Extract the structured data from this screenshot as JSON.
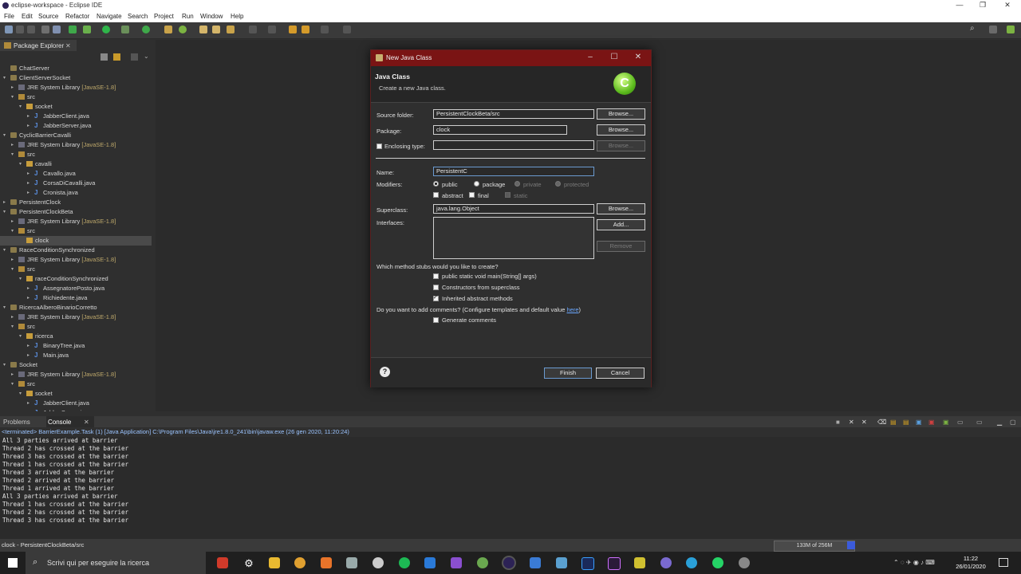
{
  "window": {
    "title": "eclipse-workspace - Eclipse IDE",
    "controls": [
      "—",
      "❐",
      "✕"
    ]
  },
  "menu": [
    "File",
    "Edit",
    "Source",
    "Refactor",
    "Navigate",
    "Search",
    "Project",
    "Run",
    "Window",
    "Help"
  ],
  "explorer": {
    "tab_label": "Package Explorer",
    "items": [
      {
        "label": "ChatServer",
        "suffix": "",
        "arrow": "",
        "icon": "project",
        "indent": 0
      },
      {
        "label": "ClientServerSocket",
        "suffix": "",
        "arrow": "▾",
        "icon": "project",
        "indent": 0
      },
      {
        "label": "JRE System Library",
        "suffix": "[JavaSE-1.8]",
        "arrow": "▸",
        "icon": "library",
        "indent": 1
      },
      {
        "label": "src",
        "suffix": "",
        "arrow": "▾",
        "icon": "src",
        "indent": 1
      },
      {
        "label": "socket",
        "suffix": "",
        "arrow": "▾",
        "icon": "package",
        "indent": 2
      },
      {
        "label": "JabberClient.java",
        "suffix": "",
        "arrow": "▸",
        "icon": "java",
        "indent": 3
      },
      {
        "label": "JabberServer.java",
        "suffix": "",
        "arrow": "▸",
        "icon": "java",
        "indent": 3
      },
      {
        "label": "CyclicBarrierCavalli",
        "suffix": "",
        "arrow": "▾",
        "icon": "project",
        "indent": 0
      },
      {
        "label": "JRE System Library",
        "suffix": "[JavaSE-1.8]",
        "arrow": "▸",
        "icon": "library",
        "indent": 1
      },
      {
        "label": "src",
        "suffix": "",
        "arrow": "▾",
        "icon": "src",
        "indent": 1
      },
      {
        "label": "cavalli",
        "suffix": "",
        "arrow": "▾",
        "icon": "package",
        "indent": 2
      },
      {
        "label": "Cavallo.java",
        "suffix": "",
        "arrow": "▸",
        "icon": "java",
        "indent": 3
      },
      {
        "label": "CorsaDiCavalli.java",
        "suffix": "",
        "arrow": "▸",
        "icon": "java",
        "indent": 3
      },
      {
        "label": "Cronista.java",
        "suffix": "",
        "arrow": "▸",
        "icon": "java",
        "indent": 3
      },
      {
        "label": "PersistentClock",
        "suffix": "",
        "arrow": "▸",
        "icon": "project",
        "indent": 0
      },
      {
        "label": "PersistentClockBeta",
        "suffix": "",
        "arrow": "▾",
        "icon": "project",
        "indent": 0
      },
      {
        "label": "JRE System Library",
        "suffix": "[JavaSE-1.8]",
        "arrow": "▸",
        "icon": "library",
        "indent": 1
      },
      {
        "label": "src",
        "suffix": "",
        "arrow": "▾",
        "icon": "src",
        "indent": 1
      },
      {
        "label": "clock",
        "suffix": "",
        "arrow": "",
        "icon": "package",
        "indent": 2,
        "selected": true
      },
      {
        "label": "RaceConditionSynchronized",
        "suffix": "",
        "arrow": "▾",
        "icon": "project",
        "indent": 0
      },
      {
        "label": "JRE System Library",
        "suffix": "[JavaSE-1.8]",
        "arrow": "▸",
        "icon": "library",
        "indent": 1
      },
      {
        "label": "src",
        "suffix": "",
        "arrow": "▾",
        "icon": "src",
        "indent": 1
      },
      {
        "label": "raceConditionSynchronized",
        "suffix": "",
        "arrow": "▾",
        "icon": "package",
        "indent": 2
      },
      {
        "label": "AssegnatorePosto.java",
        "suffix": "",
        "arrow": "▸",
        "icon": "java",
        "indent": 3
      },
      {
        "label": "Richiedente.java",
        "suffix": "",
        "arrow": "▸",
        "icon": "java",
        "indent": 3
      },
      {
        "label": "RicercaAlberoBinarioCorretto",
        "suffix": "",
        "arrow": "▾",
        "icon": "project",
        "indent": 0
      },
      {
        "label": "JRE System Library",
        "suffix": "[JavaSE-1.8]",
        "arrow": "▸",
        "icon": "library",
        "indent": 1
      },
      {
        "label": "src",
        "suffix": "",
        "arrow": "▾",
        "icon": "src",
        "indent": 1
      },
      {
        "label": "ricerca",
        "suffix": "",
        "arrow": "▾",
        "icon": "package",
        "indent": 2
      },
      {
        "label": "BinaryTree.java",
        "suffix": "",
        "arrow": "▸",
        "icon": "java",
        "indent": 3
      },
      {
        "label": "Main.java",
        "suffix": "",
        "arrow": "▸",
        "icon": "java",
        "indent": 3
      },
      {
        "label": "Socket",
        "suffix": "",
        "arrow": "▾",
        "icon": "project",
        "indent": 0
      },
      {
        "label": "JRE System Library",
        "suffix": "[JavaSE-1.8]",
        "arrow": "▸",
        "icon": "library",
        "indent": 1
      },
      {
        "label": "src",
        "suffix": "",
        "arrow": "▾",
        "icon": "src",
        "indent": 1
      },
      {
        "label": "socket",
        "suffix": "",
        "arrow": "▾",
        "icon": "package",
        "indent": 2
      },
      {
        "label": "JabberClient.java",
        "suffix": "",
        "arrow": "▸",
        "icon": "java",
        "indent": 3
      },
      {
        "label": "JabberServer.java",
        "suffix": "",
        "arrow": "▸",
        "icon": "java",
        "indent": 3
      }
    ]
  },
  "console": {
    "tabs": [
      "Problems",
      "Console"
    ],
    "info": "<terminated> BarrierExample.Task (1) [Java Application] C:\\Program Files\\Java\\jre1.8.0_241\\bin\\javaw.exe (26 gen 2020, 11:20:24)",
    "lines": [
      "All 3 parties arrived at barrier",
      "Thread 2 has crossed at the barrier",
      "Thread 3 has crossed at the barrier",
      "Thread 1 has crossed at the barrier",
      "Thread 3 arrived at the barrier",
      "Thread 2 arrived at the barrier",
      "Thread 1 arrived at the barrier",
      "All 3 parties arrived at barrier",
      "Thread 1 has crossed at the barrier",
      "Thread 2 has crossed at the barrier",
      "Thread 3 has crossed at the barrier"
    ]
  },
  "status": {
    "text": "clock - PersistentClockBeta/src",
    "heap": "133M of 256M"
  },
  "taskbar": {
    "search_placeholder": "Scrivi qui per eseguire la ricerca",
    "time": "11:22",
    "date": "26/01/2020"
  },
  "dialog": {
    "title": "New Java Class",
    "header": "Java Class",
    "subheader": "Create a new Java class.",
    "logo_letter": "C",
    "source_folder_label": "Source folder:",
    "source_folder_value": "PersistentClockBeta/src",
    "package_label": "Package:",
    "package_value": "clock",
    "enclosing_label": "Enclosing type:",
    "enclosing_value": "",
    "name_label": "Name:",
    "name_value": "PersistentC",
    "modifiers_label": "Modifiers:",
    "mod_public": "public",
    "mod_package": "package",
    "mod_private": "private",
    "mod_protected": "protected",
    "mod_abstract": "abstract",
    "mod_final": "final",
    "mod_static": "static",
    "superclass_label": "Superclass:",
    "superclass_value": "java.lang.Object",
    "interfaces_label": "Interfaces:",
    "browse": "Browse...",
    "add": "Add...",
    "remove": "Remove",
    "stubs_question": "Which method stubs would you like to create?",
    "stub_main": "public static void main(String[] args)",
    "stub_constructors": "Constructors from superclass",
    "stub_inherited": "Inherited abstract methods",
    "comments_question": "Do you want to add comments? (Configure templates and default value",
    "comments_link": "here",
    "comments_close": ")",
    "generate_comments": "Generate comments",
    "finish": "Finish",
    "cancel": "Cancel",
    "help": "?"
  }
}
